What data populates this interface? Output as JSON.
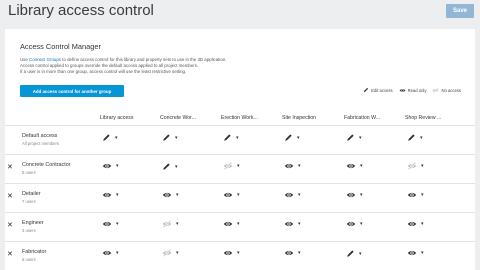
{
  "header": {
    "title": "Library access control",
    "save_label": "Save"
  },
  "panel": {
    "title": "Access Control Manager",
    "desc_line1_prefix": "Use ",
    "desc_line1_link": "Connect Groups",
    "desc_line1_suffix": " to define access control for this library and property sets to use in the 3D application.",
    "desc_line2": "Access control applied to groups override the default access applied to all project members.",
    "desc_line3": "If a user is in more than one group, access control will use the least restrictive setting.",
    "add_button": "Add access control for another group"
  },
  "legend": {
    "edit": "Edit access",
    "read": "Read only",
    "none": "No access"
  },
  "columns": [
    "Library access",
    "Concrete Wor...",
    "Erection Work...",
    "Site Inspection",
    "Fabrication W...",
    "Shop Review ..."
  ],
  "rows": [
    {
      "name": "Default access",
      "sub": "All project members",
      "removable": false,
      "access": [
        "edit",
        "edit",
        "edit",
        "edit",
        "edit",
        "edit"
      ]
    },
    {
      "name": "Concrete Contractor",
      "sub": "5 users",
      "removable": true,
      "access": [
        "read",
        "edit",
        "none",
        "read",
        "read",
        "none"
      ]
    },
    {
      "name": "Detailer",
      "sub": "7 users",
      "removable": true,
      "access": [
        "read",
        "read",
        "read",
        "read",
        "read",
        "read"
      ]
    },
    {
      "name": "Engineer",
      "sub": "3 users",
      "removable": true,
      "access": [
        "read",
        "none",
        "read",
        "read",
        "read",
        "read"
      ]
    },
    {
      "name": "Fabricator",
      "sub": "6 users",
      "removable": true,
      "access": [
        "read",
        "none",
        "read",
        "read",
        "edit",
        "read"
      ]
    }
  ],
  "colors": {
    "accent": "#0696d7",
    "save": "#93b6d6",
    "link": "#0d6dbe"
  }
}
